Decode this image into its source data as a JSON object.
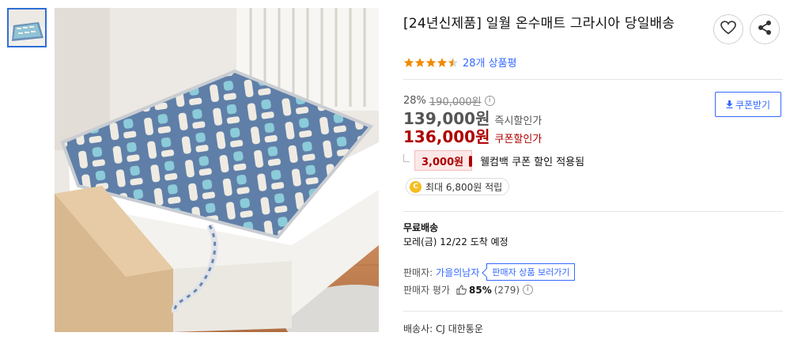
{
  "product": {
    "title": "[24년신제품] 일월 온수매트 그라시아 당일배송",
    "rating": 4.5,
    "review_count_text": "28개 상품평"
  },
  "actions": {
    "wishlist_icon": "heart-icon",
    "share_icon": "share-icon"
  },
  "price": {
    "discount_rate": "28%",
    "original_price": "190,000원",
    "sale_price": "139,000원",
    "sale_label": "즉시할인가",
    "coupon_price": "136,000원",
    "coupon_label": "쿠폰할인가",
    "coupon_button_label": "쿠폰받기",
    "welcome_coupon_amount": "3,000원",
    "welcome_coupon_text": "웰컴백 쿠폰 할인 적용됨",
    "points_coin": "C",
    "points_text": "최대 6,800원 적립"
  },
  "shipping": {
    "title": "무료배송",
    "eta": "모레(금) 12/22 도착 예정"
  },
  "seller": {
    "label": "판매자:",
    "name": "가을의남자",
    "store_button_label": "판매자 상품 보러가기",
    "eval_label": "판매자 평가",
    "eval_percent": "85%",
    "eval_count": "(279)"
  },
  "courier": {
    "text": "배송사: CJ 대한통운"
  },
  "colors": {
    "accent_blue": "#346aff",
    "price_red": "#ae0000",
    "star_orange": "#f28a00"
  }
}
